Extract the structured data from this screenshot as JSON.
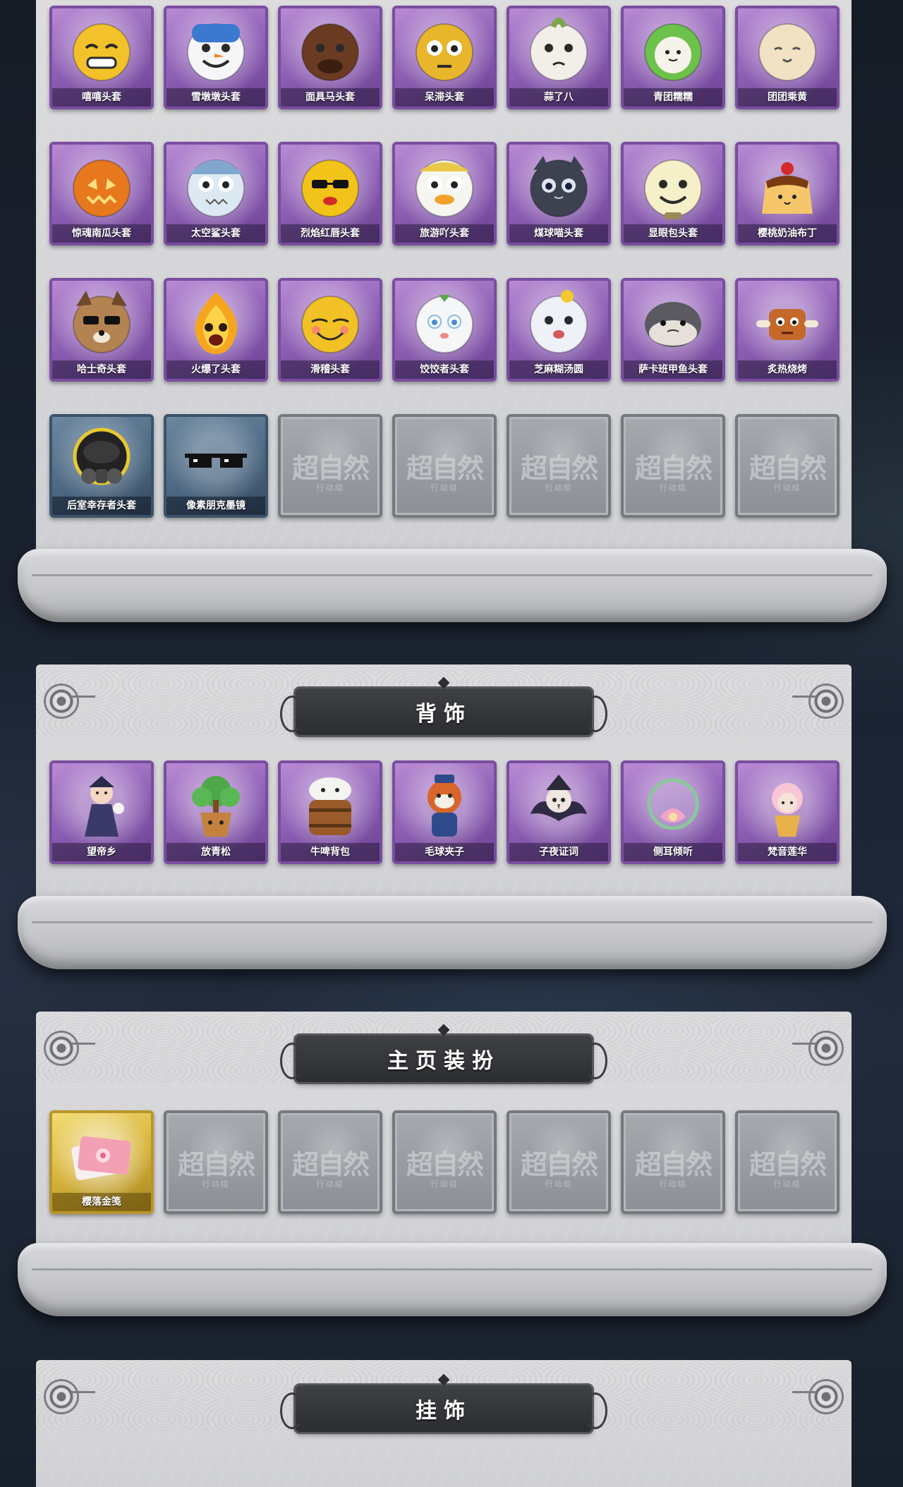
{
  "colors": {
    "card_purple": "#8e5fb4",
    "card_blue": "#4a6580",
    "card_gold": "#d7b43a",
    "card_locked": "#8c9096",
    "banner": "#2b2d30",
    "panel": "#d6d7da"
  },
  "headwear": {
    "items": [
      {
        "label": "嘻嘻头套",
        "rarity": "purple",
        "icon": "grinning-face-icon"
      },
      {
        "label": "雪墩墩头套",
        "rarity": "purple",
        "icon": "snowman-icon"
      },
      {
        "label": "面具马头套",
        "rarity": "purple",
        "icon": "horse-mask-icon"
      },
      {
        "label": "呆滞头套",
        "rarity": "purple",
        "icon": "blank-face-icon"
      },
      {
        "label": "蒜了八",
        "rarity": "purple",
        "icon": "garlic-icon"
      },
      {
        "label": "青团糯糯",
        "rarity": "purple",
        "icon": "green-bun-icon"
      },
      {
        "label": "团团乘黄",
        "rarity": "purple",
        "icon": "fluffy-creature-icon"
      },
      {
        "label": "惊魂南瓜头套",
        "rarity": "purple",
        "icon": "pumpkin-icon"
      },
      {
        "label": "太空鲨头套",
        "rarity": "purple",
        "icon": "shark-icon"
      },
      {
        "label": "烈焰红唇头套",
        "rarity": "purple",
        "icon": "sunglasses-mascot-icon"
      },
      {
        "label": "旅游吖头套",
        "rarity": "purple",
        "icon": "duck-hat-icon"
      },
      {
        "label": "煤球喵头套",
        "rarity": "purple",
        "icon": "black-cat-icon"
      },
      {
        "label": "显眼包头套",
        "rarity": "purple",
        "icon": "lightbulb-icon"
      },
      {
        "label": "樱桃奶油布丁",
        "rarity": "purple",
        "icon": "pudding-icon"
      },
      {
        "label": "哈士奇头套",
        "rarity": "purple",
        "icon": "husky-icon"
      },
      {
        "label": "火爆了头套",
        "rarity": "purple",
        "icon": "flame-icon"
      },
      {
        "label": "滑稽头套",
        "rarity": "purple",
        "icon": "funny-face-icon"
      },
      {
        "label": "饺饺者头套",
        "rarity": "purple",
        "icon": "dumpling-icon"
      },
      {
        "label": "芝麻糊汤圆",
        "rarity": "purple",
        "icon": "rice-ball-icon"
      },
      {
        "label": "萨卡班甲鱼头套",
        "rarity": "purple",
        "icon": "fish-icon"
      },
      {
        "label": "炙热烧烤",
        "rarity": "purple",
        "icon": "grilled-meat-icon"
      },
      {
        "label": "后室幸存者头套",
        "rarity": "blue",
        "icon": "gas-mask-icon"
      },
      {
        "label": "像素朋克墨镜",
        "rarity": "blue",
        "icon": "pixel-sunglasses-icon"
      },
      {
        "label": "",
        "rarity": "locked",
        "icon": "locked-icon"
      },
      {
        "label": "",
        "rarity": "locked",
        "icon": "locked-icon"
      },
      {
        "label": "",
        "rarity": "locked",
        "icon": "locked-icon"
      },
      {
        "label": "",
        "rarity": "locked",
        "icon": "locked-icon"
      },
      {
        "label": "",
        "rarity": "locked",
        "icon": "locked-icon"
      }
    ]
  },
  "backpack": {
    "title": "背饰",
    "items": [
      {
        "label": "望帝乡",
        "rarity": "purple",
        "icon": "mage-figure-icon"
      },
      {
        "label": "放青松",
        "rarity": "purple",
        "icon": "bonsai-pot-icon"
      },
      {
        "label": "牛啤背包",
        "rarity": "purple",
        "icon": "beer-barrel-cow-icon"
      },
      {
        "label": "毛球夹子",
        "rarity": "purple",
        "icon": "red-panda-icon"
      },
      {
        "label": "子夜证词",
        "rarity": "purple",
        "icon": "crow-doll-icon"
      },
      {
        "label": "侧耳倾听",
        "rarity": "purple",
        "icon": "lotus-wreath-icon"
      },
      {
        "label": "梵音莲华",
        "rarity": "purple",
        "icon": "pink-fairy-icon"
      }
    ]
  },
  "homepage": {
    "title": "主页装扮",
    "items": [
      {
        "label": "樱落金笺",
        "rarity": "gold",
        "icon": "sakura-letter-icon"
      },
      {
        "label": "",
        "rarity": "locked",
        "icon": "locked-icon"
      },
      {
        "label": "",
        "rarity": "locked",
        "icon": "locked-icon"
      },
      {
        "label": "",
        "rarity": "locked",
        "icon": "locked-icon"
      },
      {
        "label": "",
        "rarity": "locked",
        "icon": "locked-icon"
      },
      {
        "label": "",
        "rarity": "locked",
        "icon": "locked-icon"
      },
      {
        "label": "",
        "rarity": "locked",
        "icon": "locked-icon"
      }
    ]
  },
  "pendant": {
    "title": "挂饰"
  },
  "locked_placeholder": {
    "mark": "超自然",
    "sub": "行动组"
  }
}
